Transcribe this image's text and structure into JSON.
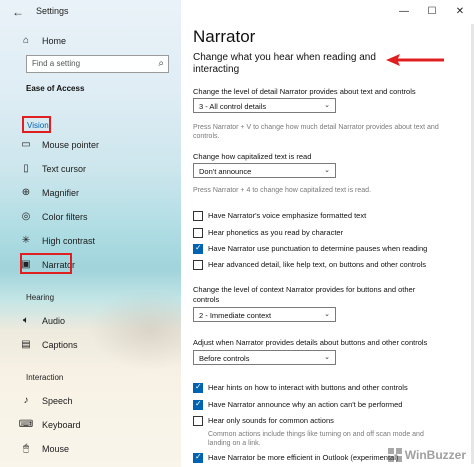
{
  "window": {
    "title": "Settings",
    "minimize": "—",
    "maximize": "☐",
    "close": "✕"
  },
  "sidebar": {
    "home": "Home",
    "search_placeholder": "Find a setting",
    "section": "Ease of Access",
    "groups": [
      {
        "heading": "Vision",
        "items": [
          "Mouse pointer",
          "Text cursor",
          "Magnifier",
          "Color filters",
          "High contrast",
          "Narrator"
        ]
      },
      {
        "heading": "Hearing",
        "items": [
          "Audio",
          "Captions"
        ]
      },
      {
        "heading": "Interaction",
        "items": [
          "Speech",
          "Keyboard",
          "Mouse"
        ]
      }
    ]
  },
  "main": {
    "title": "Narrator",
    "subtitle": "Change what you hear when reading and interacting",
    "detail": {
      "label": "Change the level of detail Narrator provides about text and controls",
      "value": "3 - All control details",
      "hint": "Press Narrator + V to change how much detail Narrator provides about text and controls."
    },
    "capitalized": {
      "label": "Change how capitalized text is read",
      "value": "Don't announce",
      "hint": "Press Narrator + 4 to change how capitalized text is read."
    },
    "checks1": [
      {
        "label": "Have Narrator's voice emphasize formatted text",
        "checked": false
      },
      {
        "label": "Hear phonetics as you read by character",
        "checked": false
      },
      {
        "label": "Have Narrator use punctuation to determine pauses when reading",
        "checked": true
      },
      {
        "label": "Hear advanced detail, like help text, on buttons and other controls",
        "checked": false
      }
    ],
    "context": {
      "label": "Change the level of context Narrator provides for buttons and other controls",
      "value": "2 - Immediate context"
    },
    "adjust": {
      "label": "Adjust when Narrator provides details about buttons and other controls",
      "value": "Before controls"
    },
    "checks2": [
      {
        "label": "Hear hints on how to interact with buttons and other controls",
        "checked": true
      },
      {
        "label": "Have Narrator announce why an action can't be performed",
        "checked": true
      },
      {
        "label": "Hear only sounds for common actions",
        "checked": false
      }
    ],
    "sounds_hint": "Common actions include things like turning on and off scan mode and landing on a link.",
    "last_check": {
      "label": "Have Narrator be more efficient in Outlook (experimental)",
      "checked": true
    }
  },
  "watermark": "WinBuzzer",
  "colors": {
    "accent": "#0063b1",
    "highlight": "#e02020"
  }
}
